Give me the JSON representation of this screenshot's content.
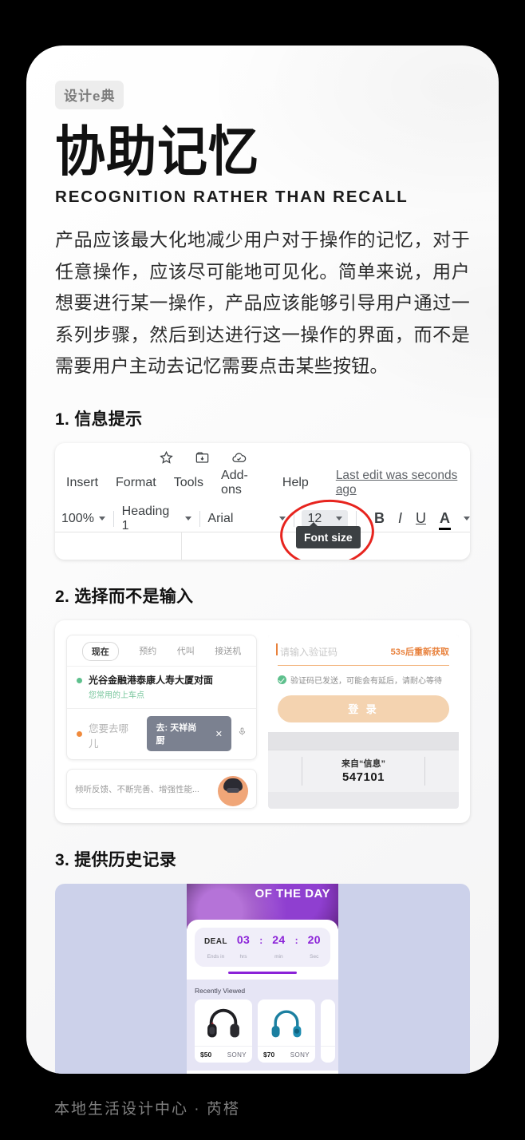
{
  "badge": {
    "text": "设计e典"
  },
  "header": {
    "title_cn": "协助记忆",
    "title_en": "RECOGNITION RATHER THAN RECALL"
  },
  "body": {
    "paragraph": "产品应该最大化地减少用户对于操作的记忆，对于任意操作，应该尽可能地可见化。简单来说，用户想要进行某一操作，产品应该能够引导用户通过一系列步骤，然后到达进行这一操作的界面，而不是需要用户主动去记忆需要点击某些按钮。"
  },
  "sections": [
    {
      "heading": "1. 信息提示"
    },
    {
      "heading": "2. 选择而不是输入"
    },
    {
      "heading": "3. 提供历史记录"
    }
  ],
  "gdocs": {
    "icons": [
      "star-icon",
      "move-to-folder-icon",
      "cloud-done-icon"
    ],
    "menu": [
      "Insert",
      "Format",
      "Tools",
      "Add-ons",
      "Help"
    ],
    "last_edit": "Last edit was seconds ago",
    "zoom": "100%",
    "paragraph_style": "Heading 1",
    "font_family": "Arial",
    "font_size": "12",
    "tooltip": "Font size",
    "format_buttons": [
      "B",
      "I",
      "U",
      "A"
    ],
    "highlight_color": "#e7241e"
  },
  "ride": {
    "tabs": [
      "现在",
      "预约",
      "代叫",
      "接送机"
    ],
    "active_tab": "现在",
    "pickup": "光谷金融港泰康人寿大厦对面",
    "pickup_sub": "您常用的上车点",
    "dest_placeholder": "您要去哪儿",
    "bubble_label": "去: 天祥尚厨",
    "bubble_close": "✕",
    "footer_text": "倾听反馈、不断完善、增强性能...",
    "accent": "#f08a3c"
  },
  "otp": {
    "placeholder": "请输入验证码",
    "resend": "53s后重新获取",
    "note": "验证码已发送，可能会有延后，请耐心等待",
    "submit": "登 录",
    "sms_from": "来自“信息”",
    "sms_code": "547101",
    "accent": "#e8813c"
  },
  "deal": {
    "hero_text": "OF THE DAY",
    "label": "DEAL",
    "label_sub": "Ends in",
    "hours": "03",
    "hours_sub": "hrs",
    "minutes": "24",
    "minutes_sub": "min",
    "seconds": "20",
    "seconds_sub": "Sec",
    "separator": ":",
    "recently_viewed": "Recently Viewed",
    "accent": "#8b22d8",
    "products": [
      {
        "price": "$50",
        "brand": "SONY",
        "color": "#1f1f23"
      },
      {
        "price": "$70",
        "brand": "SONY",
        "color": "#1b7fa0"
      }
    ]
  },
  "footer": {
    "text": "本地生活设计中心 · 芮榙"
  }
}
